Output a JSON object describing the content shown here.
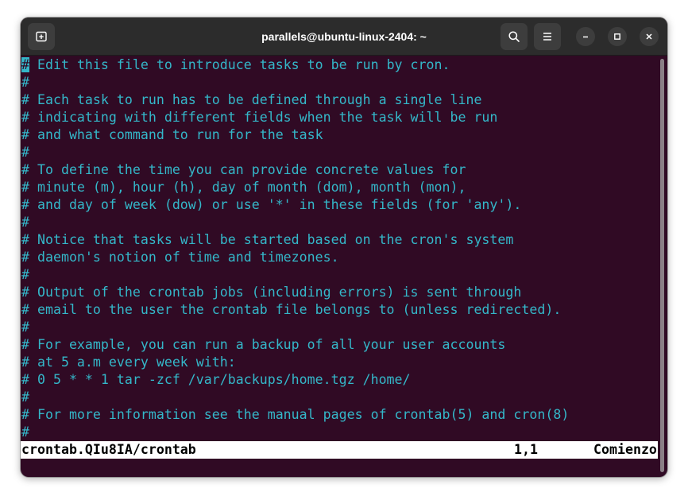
{
  "window": {
    "title": "parallels@ubuntu-linux-2404: ~"
  },
  "titlebar": {
    "icons": [
      "new-tab-icon",
      "search-icon",
      "menu-icon",
      "minimize-icon",
      "maximize-icon",
      "close-icon"
    ]
  },
  "terminal": {
    "colors": {
      "background": "#300a24",
      "text": "#34b7c9"
    },
    "cursor_char": "#",
    "lines": [
      " Edit this file to introduce tasks to be run by cron.",
      "#",
      "# Each task to run has to be defined through a single line",
      "# indicating with different fields when the task will be run",
      "# and what command to run for the task",
      "#",
      "# To define the time you can provide concrete values for",
      "# minute (m), hour (h), day of month (dom), month (mon),",
      "# and day of week (dow) or use '*' in these fields (for 'any').",
      "#",
      "# Notice that tasks will be started based on the cron's system",
      "# daemon's notion of time and timezones.",
      "#",
      "# Output of the crontab jobs (including errors) is sent through",
      "# email to the user the crontab file belongs to (unless redirected).",
      "#",
      "# For example, you can run a backup of all your user accounts",
      "# at 5 a.m every week with:",
      "# 0 5 * * 1 tar -zcf /var/backups/home.tgz /home/",
      "#",
      "# For more information see the manual pages of crontab(5) and cron(8)",
      "#"
    ]
  },
  "statusbar": {
    "filename": "crontab.QIu8IA/crontab",
    "position": "1,1",
    "scroll": "Comienzo"
  }
}
